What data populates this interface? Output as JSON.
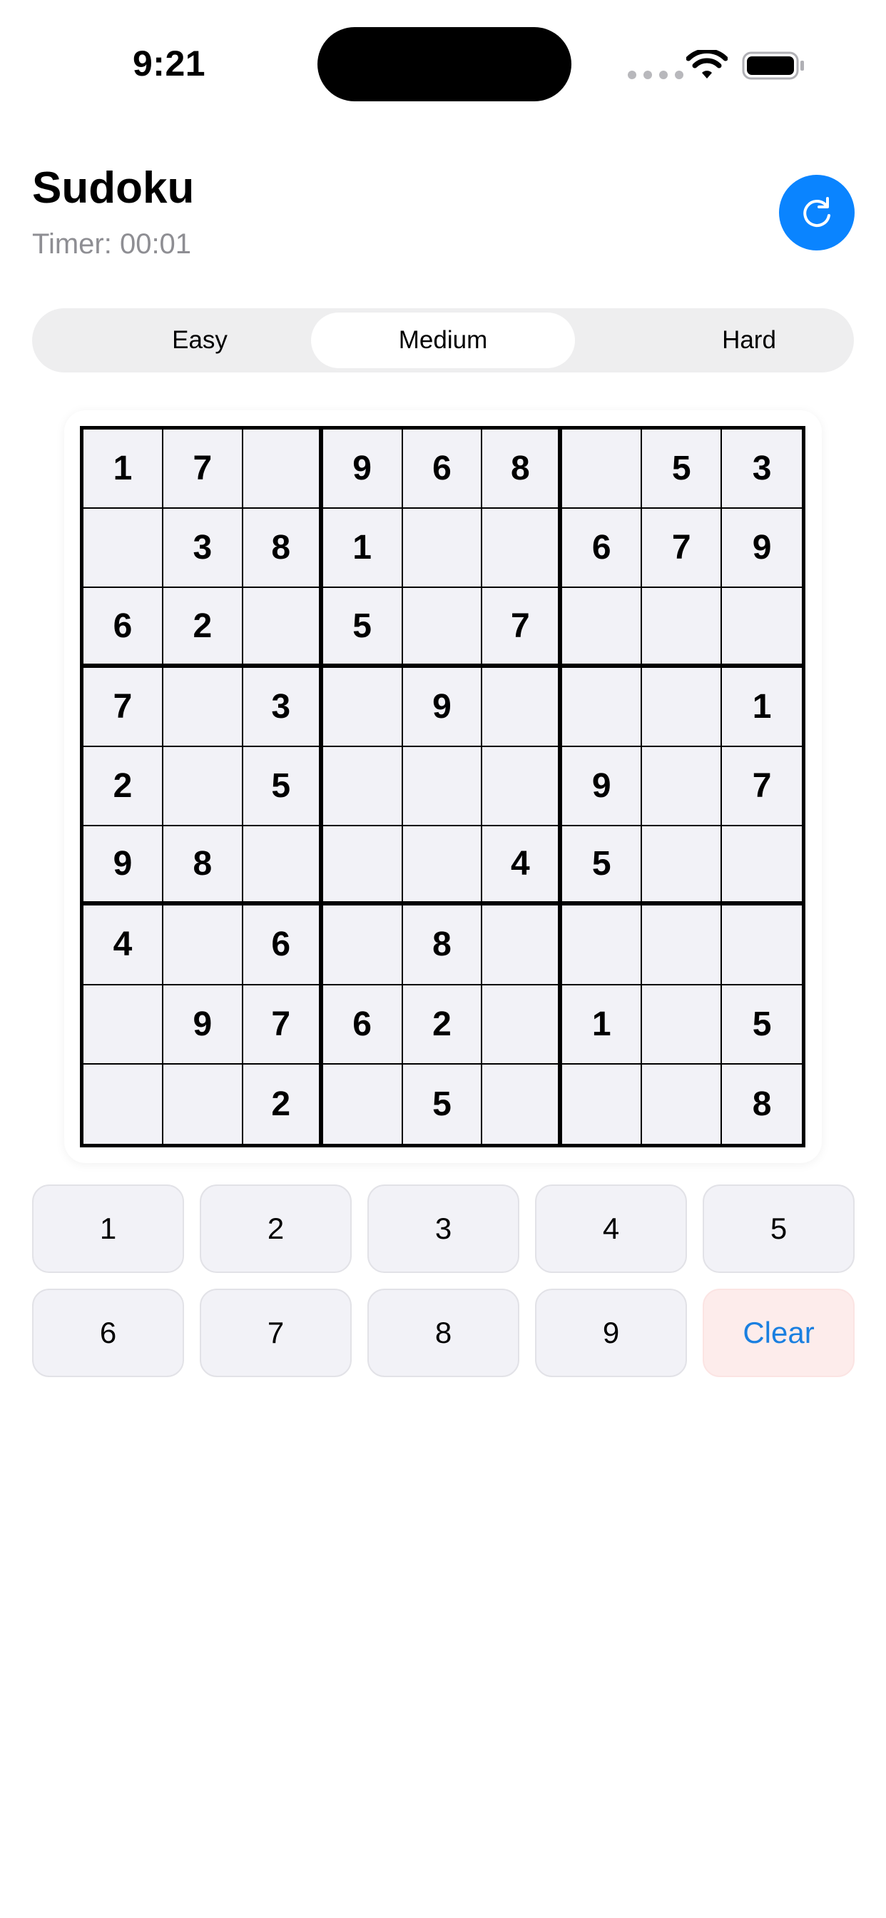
{
  "status_bar": {
    "time": "9:21"
  },
  "header": {
    "title": "Sudoku",
    "timer": "Timer: 00:01",
    "restart_icon": "refresh-icon",
    "accent_color": "#0a84ff"
  },
  "difficulty": {
    "options": [
      "Easy",
      "Medium",
      "Hard"
    ],
    "selected": "Medium"
  },
  "board": {
    "rows": [
      [
        "1",
        "7",
        "",
        "9",
        "6",
        "8",
        "",
        "5",
        "3"
      ],
      [
        "",
        "3",
        "8",
        "1",
        "",
        "",
        "6",
        "7",
        "9"
      ],
      [
        "6",
        "2",
        "",
        "5",
        "",
        "7",
        "",
        "",
        ""
      ],
      [
        "7",
        "",
        "3",
        "",
        "9",
        "",
        "",
        "",
        "1"
      ],
      [
        "2",
        "",
        "5",
        "",
        "",
        "",
        "9",
        "",
        "7"
      ],
      [
        "9",
        "8",
        "",
        "",
        "",
        "4",
        "5",
        "",
        ""
      ],
      [
        "4",
        "",
        "6",
        "",
        "8",
        "",
        "",
        "",
        ""
      ],
      [
        "",
        "9",
        "7",
        "6",
        "2",
        "",
        "1",
        "",
        "5"
      ],
      [
        "",
        "",
        "2",
        "",
        "5",
        "",
        "",
        "",
        "8"
      ]
    ]
  },
  "number_pad": {
    "keys": [
      "1",
      "2",
      "3",
      "4",
      "5",
      "6",
      "7",
      "8",
      "9"
    ],
    "clear_label": "Clear"
  }
}
